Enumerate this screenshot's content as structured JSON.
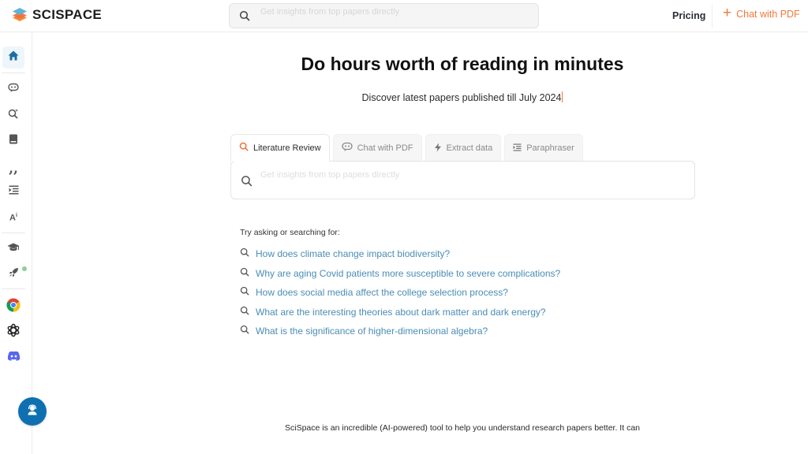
{
  "header": {
    "brand": "SCISPACE",
    "search_placeholder": "Get insights from top papers directly",
    "pricing_label": "Pricing",
    "chat_pdf_label": "Chat with PDF",
    "accent_color": "#f0783c"
  },
  "sidebar": {
    "items": [
      {
        "icon": "home-icon",
        "active": true
      },
      {
        "icon": "chat-bot-icon"
      },
      {
        "icon": "search-spark-icon"
      },
      {
        "icon": "notebook-icon"
      },
      {
        "icon": "quote-icon"
      },
      {
        "icon": "paraphrase-icon"
      },
      {
        "icon": "ai-detector-icon"
      },
      {
        "icon": "graduation-cap-icon"
      },
      {
        "icon": "rocket-icon",
        "badge": "new-dot"
      },
      {
        "icon": "chrome-icon"
      },
      {
        "icon": "openai-icon"
      },
      {
        "icon": "discord-icon"
      }
    ],
    "active_color": "#1a6fa3",
    "support_button_color": "#0f70b1"
  },
  "main": {
    "title": "Do hours worth of reading in minutes",
    "subtitle": "Discover latest papers published till July 2024",
    "tabs": [
      {
        "label": "Literature Review",
        "icon": "search-icon",
        "active": true
      },
      {
        "label": "Chat with PDF",
        "icon": "chat-bot-icon"
      },
      {
        "label": "Extract data",
        "icon": "lightning-icon"
      },
      {
        "label": "Paraphraser",
        "icon": "paraphrase-icon"
      }
    ],
    "search_placeholder": "Get insights from top papers directly",
    "try_label": "Try asking or searching for:",
    "suggestions": [
      "How does climate change impact biodiversity?",
      "Why are aging Covid patients more susceptible to severe complications?",
      "How does social media affect the college selection process?",
      "What are the interesting theories about dark matter and dark energy?",
      "What is the significance of higher-dimensional algebra?"
    ],
    "link_color": "#4a8db4"
  },
  "footer": {
    "text": "SciSpace is an incredible (AI-powered) tool to help you understand research papers better. It can"
  }
}
